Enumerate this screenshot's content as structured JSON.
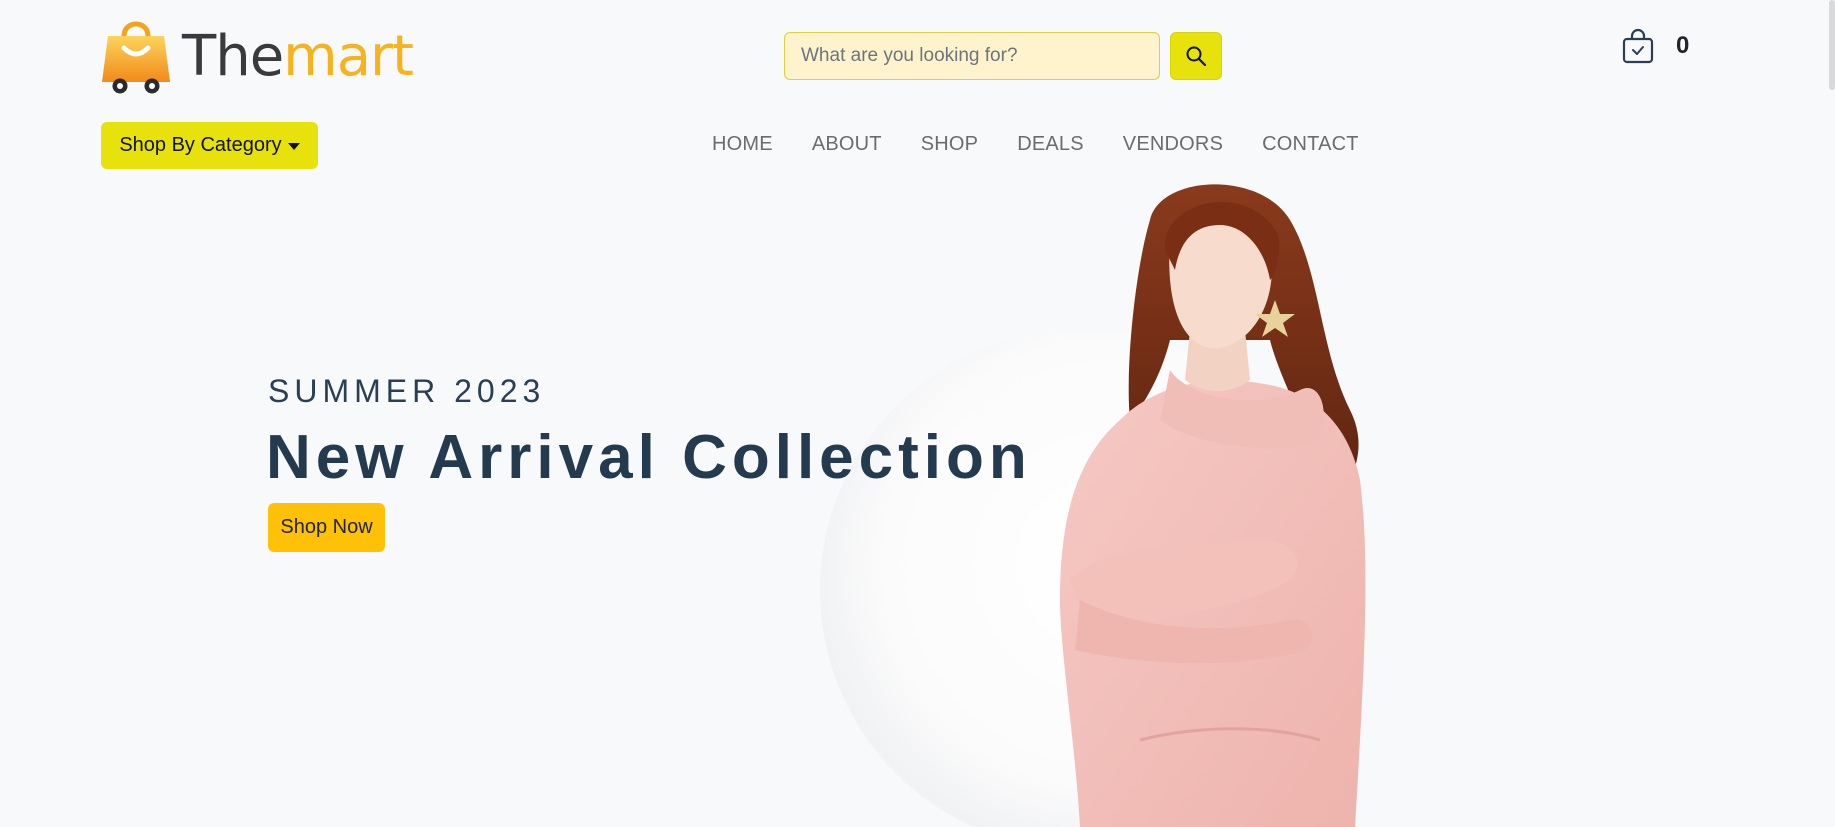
{
  "brand": {
    "name_part1": "The",
    "name_part2": "mart",
    "logo_icon": "shopping-bag-cart-icon",
    "colors": {
      "primary_orange": "#f8b21b",
      "dark_text": "#3a3a3a"
    }
  },
  "search": {
    "placeholder": "What are you looking for?",
    "value": "",
    "button_icon": "search-icon"
  },
  "cart": {
    "icon": "shopping-bag-check-icon",
    "count": "0"
  },
  "category_menu": {
    "label": "Shop By Category",
    "icon": "caret-down-icon"
  },
  "nav": {
    "items": [
      {
        "label": "HOME"
      },
      {
        "label": "ABOUT"
      },
      {
        "label": "SHOP"
      },
      {
        "label": "DEALS"
      },
      {
        "label": "VENDORS"
      },
      {
        "label": "CONTACT"
      }
    ]
  },
  "hero": {
    "kicker": "SUMMER 2023",
    "title": "New Arrival Collection",
    "cta_label": "Shop Now",
    "image": "model-in-pink-hoodie"
  },
  "colors": {
    "accent_yellow": "#e8e20c",
    "cta_amber": "#ffc107",
    "search_bg": "#fff3cd",
    "heading_navy": "#233a4f",
    "page_bg": "#f8f9fa"
  }
}
